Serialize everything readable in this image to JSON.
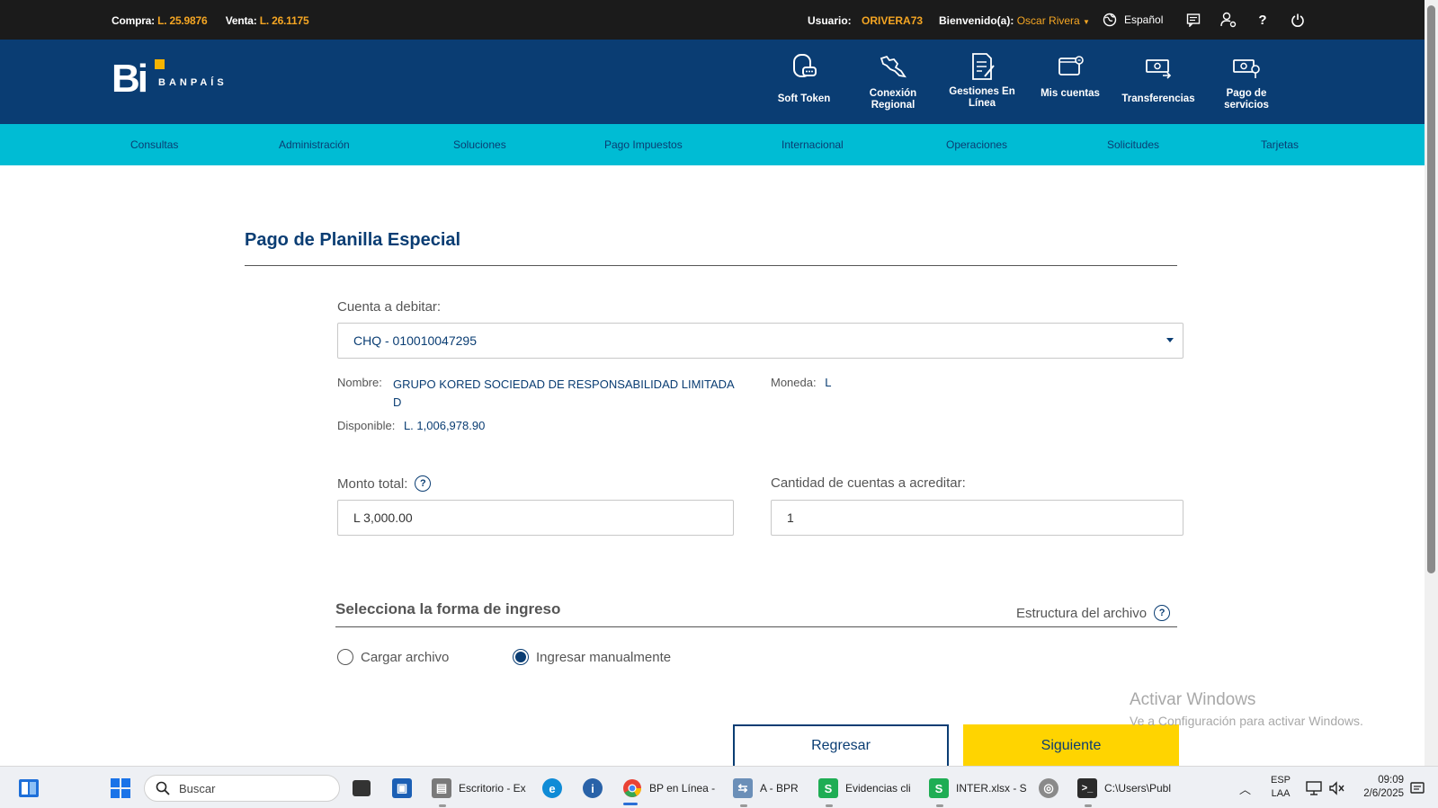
{
  "topbar": {
    "compra_label": "Compra:",
    "compra_value": "L. 25.9876",
    "venta_label": "Venta:",
    "venta_value": "L. 26.1175",
    "usuario_label": "Usuario:",
    "usuario_value": "ORIVERA73",
    "welcome_label": "Bienvenido(a):",
    "welcome_name": "Oscar Rivera",
    "language": "Español"
  },
  "header": {
    "logo_text": "Bi",
    "brand": "BANPAÍS",
    "nav": [
      {
        "label": "Soft Token"
      },
      {
        "label": "Conexión Regional"
      },
      {
        "label": "Gestiones En Línea"
      },
      {
        "label": "Mis cuentas"
      },
      {
        "label": "Transferencias"
      },
      {
        "label": "Pago de servicios"
      }
    ]
  },
  "menu": [
    "Consultas",
    "Administración",
    "Soluciones",
    "Pago Impuestos",
    "Internacional",
    "Operaciones",
    "Solicitudes",
    "Tarjetas"
  ],
  "page": {
    "title": "Pago de Planilla Especial",
    "cuenta_label": "Cuenta a debitar:",
    "cuenta_value": "CHQ - 010010047295",
    "nombre_label": "Nombre:",
    "nombre_line1": "GRUPO KORED SOCIEDAD DE RESPONSABILIDAD LIMITADA",
    "nombre_line2": "D",
    "moneda_label": "Moneda:",
    "moneda_value": "L",
    "disponible_label": "Disponible:",
    "disponible_value": "L. 1,006,978.90",
    "monto_label": "Monto total:",
    "monto_value": "L 3,000.00",
    "cantidad_label": "Cantidad de cuentas a acreditar:",
    "cantidad_value": "1",
    "section_title": "Selecciona la forma de ingreso",
    "estructura_link": "Estructura del archivo",
    "radio_cargar": "Cargar archivo",
    "radio_manual": "Ingresar manualmente",
    "btn_back": "Regresar",
    "btn_next": "Siguiente"
  },
  "watermark": {
    "line1": "Activar Windows",
    "line2": "Ve a Configuración para activar Windows."
  },
  "taskbar": {
    "search_placeholder": "Buscar",
    "apps": [
      {
        "label": "Escritorio - Ex"
      },
      {
        "label": "BP en Línea -"
      },
      {
        "label": "A - BPR"
      },
      {
        "label": "Evidencias cli"
      },
      {
        "label": "INTER.xlsx - S"
      },
      {
        "label": "C:\\Users\\Publ"
      }
    ],
    "lang_line1": "ESP",
    "lang_line2": "LAA",
    "time": "09:09",
    "date": "2/6/2025"
  },
  "colors": {
    "navy": "#0a3d73",
    "cyan": "#00bcd4",
    "accent_orange": "#f5a623",
    "yellow_button": "#ffd400"
  }
}
